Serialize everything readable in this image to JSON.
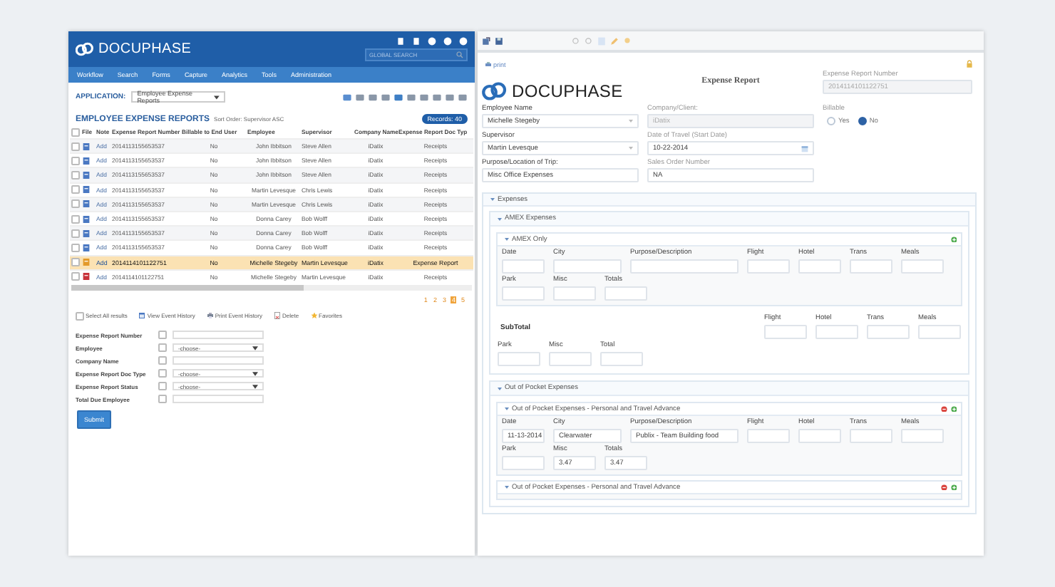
{
  "left": {
    "logo": "**DOCU**PHASE",
    "search_placeholder": "GLOBAL SEARCH",
    "nav": [
      "Workflow",
      "Search",
      "Forms",
      "Capture",
      "Analytics",
      "Tools",
      "Administration"
    ],
    "application": {
      "label": "APPLICATION:",
      "value": "Employee Expense Reports"
    },
    "report": {
      "title": "EMPLOYEE EXPENSE REPORTS",
      "sort": "Sort Order: Supervisor ASC",
      "records": "Records: 40"
    },
    "header_checked": false,
    "columns": [
      "File",
      "Note",
      "Expense Report Number",
      "Billable to End User",
      "Employee",
      "Supervisor",
      "Company Name",
      "Expense Report Doc Typ"
    ],
    "rows": [
      {
        "checked": false,
        "color": "#4a78c2",
        "note": "Add",
        "number": "2014113155653537",
        "billable": "No",
        "employee": "John Ibbitson",
        "supervisor": "Steve Allen",
        "company": "iDatix",
        "doc_type": "Receipts",
        "selected": false
      },
      {
        "checked": false,
        "color": "#4a78c2",
        "note": "Add",
        "number": "2014113155653537",
        "billable": "No",
        "employee": "John Ibbitson",
        "supervisor": "Steve Allen",
        "company": "iDatix",
        "doc_type": "Receipts",
        "selected": false
      },
      {
        "checked": false,
        "color": "#4a78c2",
        "note": "Add",
        "number": "2014113155653537",
        "billable": "No",
        "employee": "John Ibbitson",
        "supervisor": "Steve Allen",
        "company": "iDatix",
        "doc_type": "Receipts",
        "selected": false
      },
      {
        "checked": false,
        "color": "#4a78c2",
        "note": "Add",
        "number": "2014113155653537",
        "billable": "No",
        "employee": "Martin Levesque",
        "supervisor": "Chris Lewis",
        "company": "iDatix",
        "doc_type": "Receipts",
        "selected": false
      },
      {
        "checked": false,
        "color": "#4a78c2",
        "note": "Add",
        "number": "2014113155653537",
        "billable": "No",
        "employee": "Martin Levesque",
        "supervisor": "Chris Lewis",
        "company": "iDatix",
        "doc_type": "Receipts",
        "selected": false
      },
      {
        "checked": false,
        "color": "#4a78c2",
        "note": "Add",
        "number": "2014113155653537",
        "billable": "No",
        "employee": "Donna Carey",
        "supervisor": "Bob Wolff",
        "company": "iDatix",
        "doc_type": "Receipts",
        "selected": false
      },
      {
        "checked": false,
        "color": "#4a78c2",
        "note": "Add",
        "number": "2014113155653537",
        "billable": "No",
        "employee": "Donna Carey",
        "supervisor": "Bob Wolff",
        "company": "iDatix",
        "doc_type": "Receipts",
        "selected": false
      },
      {
        "checked": false,
        "color": "#4a78c2",
        "note": "Add",
        "number": "2014113155653537",
        "billable": "No",
        "employee": "Donna Carey",
        "supervisor": "Bob Wolff",
        "company": "iDatix",
        "doc_type": "Receipts",
        "selected": false
      },
      {
        "checked": false,
        "color": "#e39a2b",
        "note": "Add",
        "number": "2014114101122751",
        "billable": "No",
        "employee": "Michelle Stegeby",
        "supervisor": "Martin Levesque",
        "company": "iDatix",
        "doc_type": "Expense Report",
        "selected": true
      },
      {
        "checked": false,
        "color": "#c8323a",
        "note": "Add",
        "number": "2014114101122751",
        "billable": "No",
        "employee": "Michelle Stegeby",
        "supervisor": "Martin Levesque",
        "company": "iDatix",
        "doc_type": "Receipts",
        "selected": false
      }
    ],
    "pages": [
      {
        "label": "1",
        "selected": false
      },
      {
        "label": "2",
        "selected": false
      },
      {
        "label": "3",
        "selected": false
      },
      {
        "label": "4",
        "selected": true
      },
      {
        "label": "5",
        "selected": false
      }
    ],
    "actions": [
      {
        "kind": "checkbox",
        "label": "Select All results",
        "checked": false
      },
      {
        "kind": "history",
        "label": "View Event History"
      },
      {
        "kind": "print",
        "label": "Print Event History"
      },
      {
        "kind": "delete",
        "label": "Delete"
      },
      {
        "kind": "star",
        "label": "Favorites"
      }
    ],
    "filters": [
      {
        "kind": "text",
        "label": "Expense Report Number",
        "checked": false
      },
      {
        "kind": "select",
        "label": "Employee",
        "value": "-choose-",
        "checked": false
      },
      {
        "kind": "text",
        "label": "Company Name",
        "checked": false
      },
      {
        "kind": "select",
        "label": "Expense Report Doc Type",
        "value": "-choose-",
        "checked": false
      },
      {
        "kind": "select",
        "label": "Expense Report Status",
        "value": "-choose-",
        "checked": false
      },
      {
        "kind": "text",
        "label": "Total Due Employee",
        "checked": false
      }
    ],
    "submit": "Submit"
  },
  "right": {
    "print": "print",
    "form_rows": [
      [
        {
          "kind": "logo",
          "text": "**DOCU**PHASE"
        },
        {
          "kind": "title",
          "text": "Expense Report"
        },
        {
          "kind": "readonly",
          "label": "Expense Report Number",
          "value": "2014114101122751"
        }
      ],
      [
        {
          "kind": "select",
          "label": "Employee Name",
          "value": "Michelle Stegeby"
        },
        {
          "kind": "readonly",
          "label": "Company/Client:",
          "value": "iDatix"
        },
        {
          "kind": "radio",
          "label": "Billable",
          "options": [
            {
              "label": "Yes",
              "selected": false
            },
            {
              "label": "No",
              "selected": true
            }
          ]
        }
      ],
      [
        {
          "kind": "select",
          "label": "Supervisor",
          "value": "Martin Levesque"
        },
        {
          "kind": "date",
          "label": "Date of Travel (Start Date)",
          "value": "10-22-2014"
        }
      ],
      [
        {
          "kind": "text",
          "label": "Purpose/Location of Trip:",
          "value": "Misc Office Expenses"
        },
        {
          "kind": "text",
          "label": "Sales Order Number",
          "value": "NA"
        }
      ]
    ],
    "section": {
      "title": "Expenses",
      "groups": [
        {
          "title": "AMEX Expenses",
          "items": [
            {
              "kind": "repeat",
              "title": "AMEX Only",
              "removable": false,
              "lines": [
                [
                  {
                    "kind": "short",
                    "label": "Date"
                  },
                  {
                    "kind": "medium",
                    "label": "City"
                  },
                  {
                    "kind": "long",
                    "label": "Purpose/Description"
                  },
                  {
                    "kind": "short",
                    "label": "Flight"
                  },
                  {
                    "kind": "short",
                    "label": "Hotel"
                  },
                  {
                    "kind": "short",
                    "label": "Trans"
                  },
                  {
                    "kind": "short",
                    "label": "Meals"
                  }
                ],
                [
                  {
                    "kind": "short",
                    "label": "Park"
                  },
                  {
                    "kind": "short",
                    "label": "Misc"
                  },
                  {
                    "kind": "short",
                    "label": "Totals"
                  }
                ]
              ]
            },
            {
              "kind": "subtotal",
              "title": "SubTotal",
              "lines": [
                [
                  {
                    "kind": "short",
                    "label": "Flight"
                  },
                  {
                    "kind": "short",
                    "label": "Hotel"
                  },
                  {
                    "kind": "short",
                    "label": "Trans"
                  },
                  {
                    "kind": "short",
                    "label": "Meals"
                  }
                ],
                [
                  {
                    "kind": "short",
                    "label": "Park"
                  },
                  {
                    "kind": "short",
                    "label": "Misc"
                  },
                  {
                    "kind": "short",
                    "label": "Total"
                  }
                ]
              ]
            }
          ]
        },
        {
          "title": "Out of Pocket Expenses",
          "items": [
            {
              "kind": "repeat",
              "title": "Out of Pocket Expenses - Personal and Travel Advance",
              "removable": true,
              "lines": [
                [
                  {
                    "kind": "short",
                    "label": "Date",
                    "value": "11-13-2014"
                  },
                  {
                    "kind": "medium",
                    "label": "City",
                    "value": "Clearwater"
                  },
                  {
                    "kind": "long",
                    "label": "Purpose/Description",
                    "value": "Publix - Team Building food"
                  },
                  {
                    "kind": "short",
                    "label": "Flight"
                  },
                  {
                    "kind": "short",
                    "label": "Hotel"
                  },
                  {
                    "kind": "short",
                    "label": "Trans"
                  },
                  {
                    "kind": "short",
                    "label": "Meals"
                  }
                ],
                [
                  {
                    "kind": "short",
                    "label": "Park"
                  },
                  {
                    "kind": "short",
                    "label": "Misc",
                    "value": "3.47"
                  },
                  {
                    "kind": "short",
                    "label": "Totals",
                    "value": "3.47"
                  }
                ]
              ]
            },
            {
              "kind": "repeat",
              "title": "Out of Pocket Expenses - Personal and Travel Advance",
              "removable": true
            }
          ]
        }
      ]
    }
  }
}
